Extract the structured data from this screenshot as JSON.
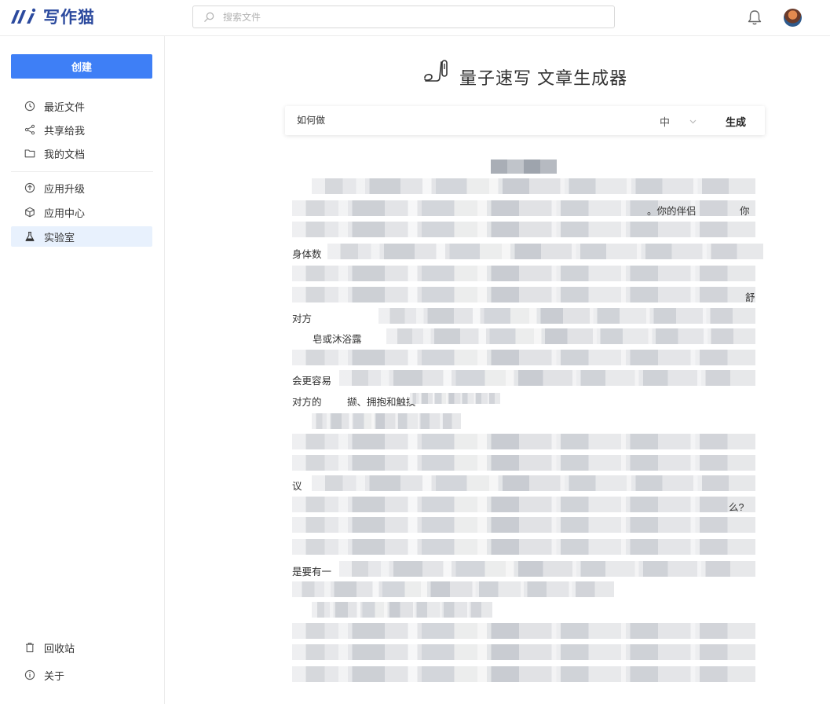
{
  "app": {
    "logo_text": "写作猫"
  },
  "search": {
    "placeholder": "搜索文件"
  },
  "sidebar": {
    "create_label": "创建",
    "items": [
      {
        "label": "最近文件",
        "icon": "clock-icon"
      },
      {
        "label": "共享给我",
        "icon": "share-icon"
      },
      {
        "label": "我的文档",
        "icon": "folder-icon"
      },
      {
        "label": "应用升级",
        "icon": "arrow-up-circle-icon"
      },
      {
        "label": "应用中心",
        "icon": "cube-icon"
      },
      {
        "label": "实验室",
        "icon": "flask-icon",
        "active": true
      },
      {
        "label": "回收站",
        "icon": "trash-icon"
      },
      {
        "label": "关于",
        "icon": "info-icon"
      }
    ]
  },
  "main": {
    "title": "量子速写 文章生成器",
    "prompt_value": "如何做",
    "size_value": "中",
    "generate_label": "生成"
  },
  "article": {
    "fragments": [
      "。你的伴侣",
      "你",
      "身体数",
      "舒",
      "对方",
      "皂或沐浴露",
      "会更容易",
      "对方的",
      "撷、拥抱和触摸",
      "议",
      "么?",
      "是要有一"
    ]
  },
  "colors": {
    "accent": "#3e7ff6",
    "active_bg": "#e8f1fd",
    "logo": "#2c4a9e"
  }
}
